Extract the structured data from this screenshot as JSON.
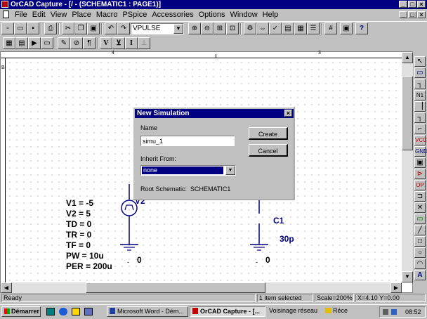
{
  "window": {
    "title": "OrCAD Capture - [/ - (SCHEMATIC1 : PAGE1)]"
  },
  "menu": [
    "File",
    "Edit",
    "View",
    "Place",
    "Macro",
    "PSpice",
    "Accessories",
    "Options",
    "Window",
    "Help"
  ],
  "toolbar": {
    "part_combo": "VPULSE"
  },
  "ruler": {
    "marks": [
      "4",
      "3"
    ]
  },
  "dialog": {
    "title": "New Simulation",
    "name_label": "Name",
    "name_value": "simu_1",
    "inherit_label": "Inherit From:",
    "inherit_value": "none",
    "root_label": "Root Schematic:",
    "root_value": "SCHEMATIC1",
    "create_label": "Create",
    "cancel_label": "Cancel"
  },
  "schematic": {
    "v2_label": "V2",
    "params": [
      "V1 = -5",
      "V2 = 5",
      "TD = 0",
      "TR = 0",
      "TF = 0",
      "PW = 10u",
      "PER = 200u"
    ],
    "c1_label": "C1",
    "c1_value": "30p",
    "ground1": "0",
    "ground2": "0"
  },
  "statusbar": {
    "ready": "Ready",
    "selected": "1 item selected",
    "scale": "Scale=200%",
    "coords": "X=4.10  Y=0.00"
  },
  "taskbar": {
    "start": "Démarrer",
    "tasks": [
      "Microsoft Word - Dém...",
      "OrCAD Capture - [...",
      "Voisinage réseau",
      "Réce"
    ],
    "clock": "08:52"
  }
}
